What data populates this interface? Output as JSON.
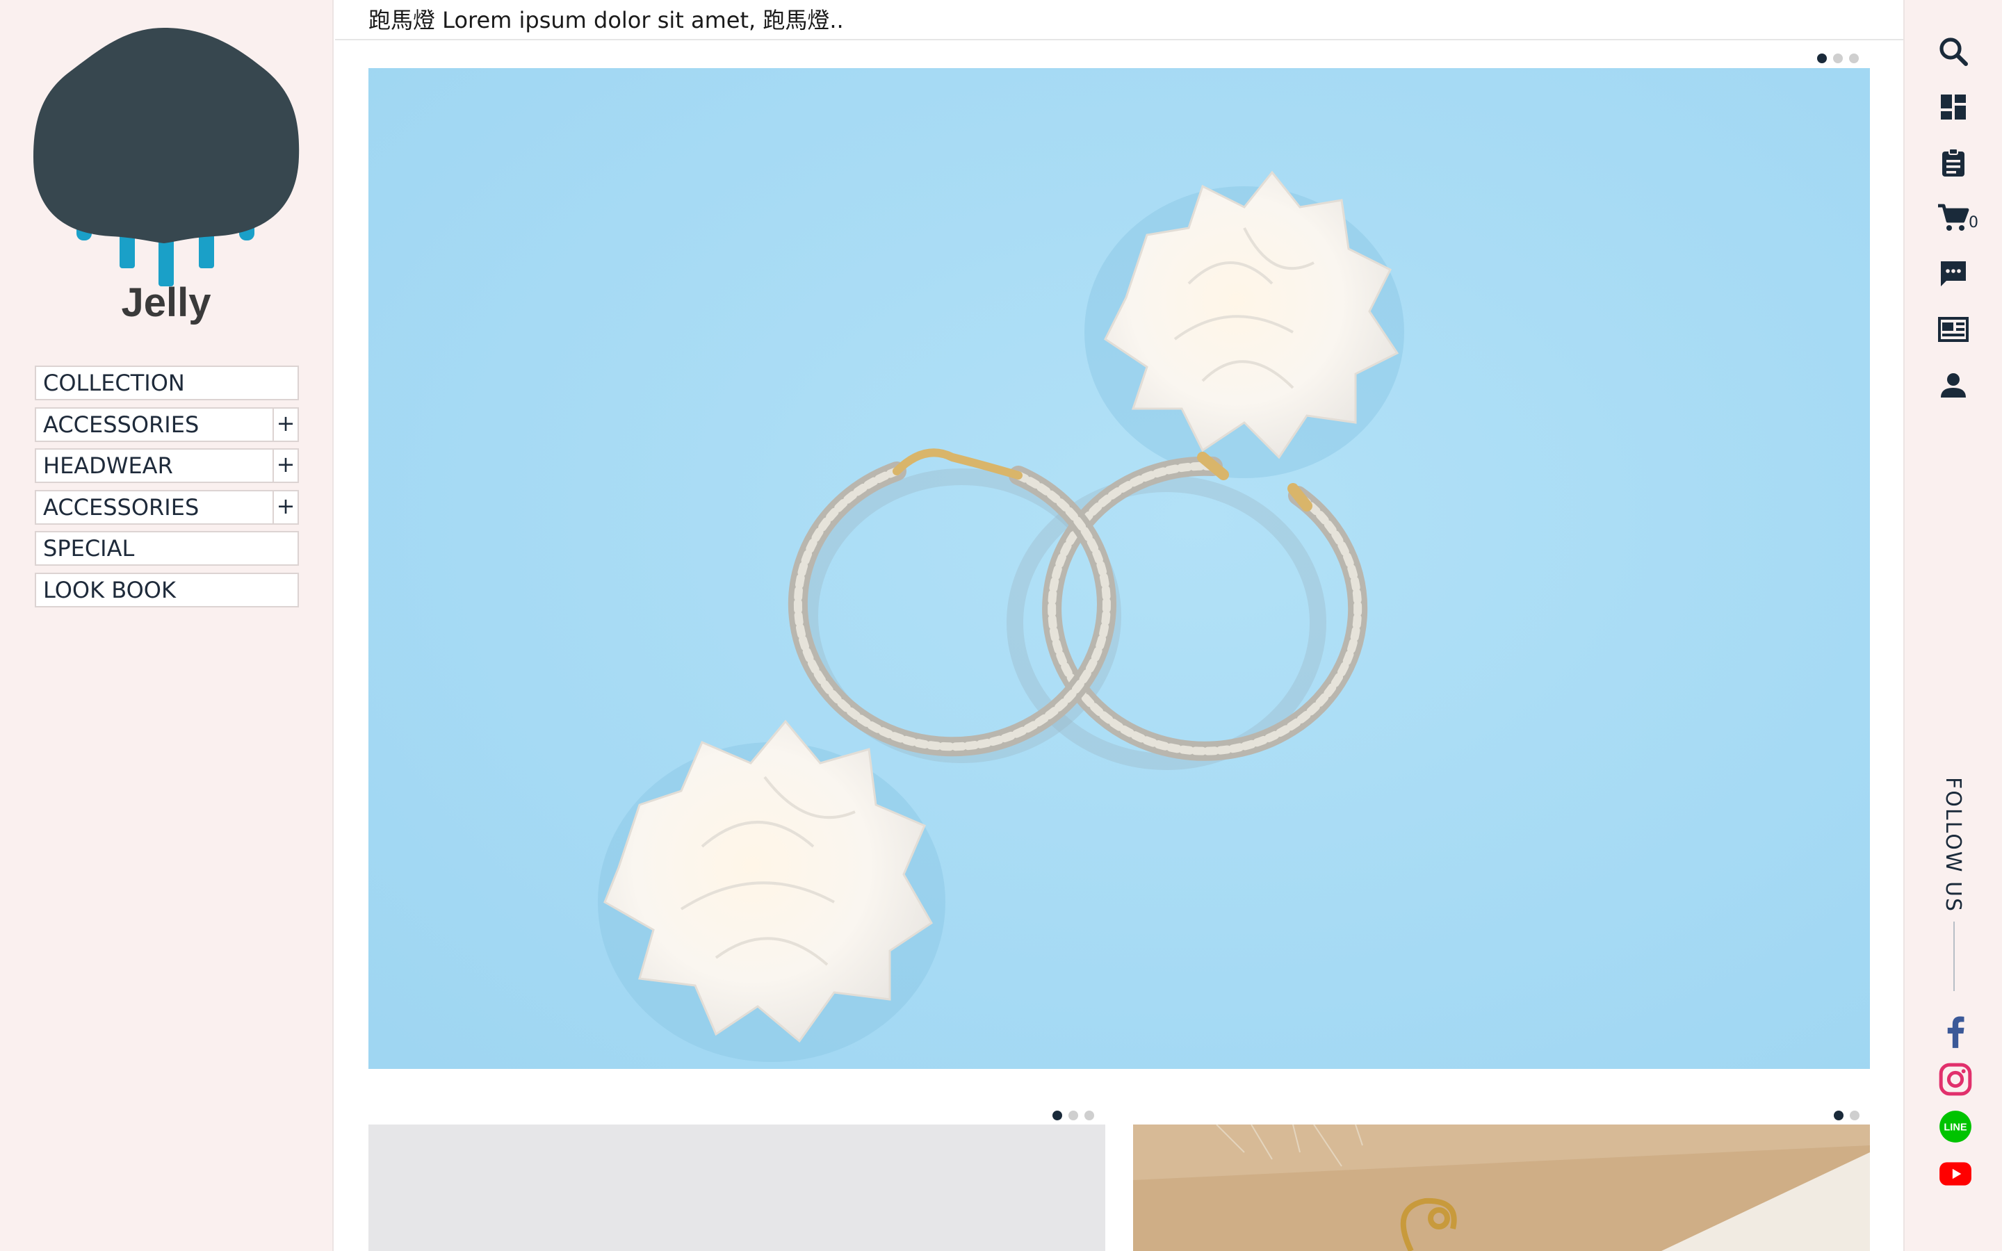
{
  "brand": {
    "name": "Jelly"
  },
  "nav": {
    "items": [
      {
        "label": "COLLECTION",
        "expandable": false
      },
      {
        "label": "ACCESSORIES",
        "expandable": true
      },
      {
        "label": "HEADWEAR",
        "expandable": true
      },
      {
        "label": "ACCESSORIES",
        "expandable": true
      },
      {
        "label": "SPECIAL",
        "expandable": false
      },
      {
        "label": "LOOK BOOK",
        "expandable": false
      }
    ],
    "expand_symbol": "+"
  },
  "marquee": {
    "text": "跑馬燈 Lorem ipsum dolor sit amet, 跑馬燈.."
  },
  "toolbar": {
    "icons": [
      "search-icon",
      "dashboard-icon",
      "clipboard-icon",
      "cart-icon",
      "chat-icon",
      "news-icon",
      "user-icon"
    ],
    "cart_count": "0"
  },
  "follow": {
    "label": "FOLLOW US",
    "networks": [
      "facebook",
      "instagram",
      "line",
      "youtube"
    ],
    "line_label": "LINE"
  },
  "colors": {
    "sidebar_bg": "#faf0ef",
    "nav_text": "#1e2a3a",
    "logo_dark": "#37474f",
    "logo_accent": "#1aa0c8",
    "hero_bg": "#a8dcf5",
    "facebook": "#3b5998",
    "instagram": "#e1306c",
    "line": "#00c300",
    "youtube": "#ff0000"
  }
}
